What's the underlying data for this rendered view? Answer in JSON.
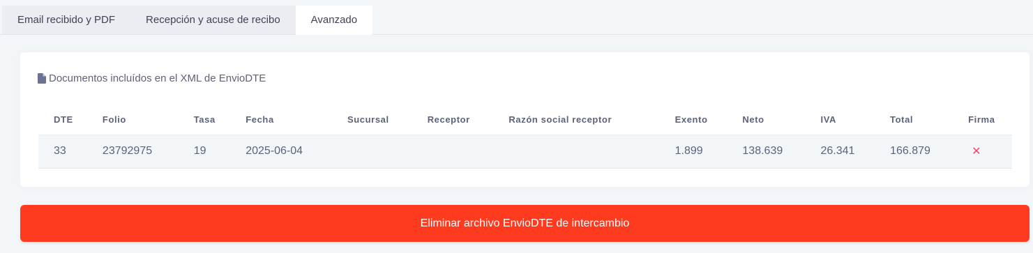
{
  "tabs": [
    {
      "label": "Email recibido y PDF"
    },
    {
      "label": "Recepción y acuse de recibo"
    },
    {
      "label": "Avanzado"
    }
  ],
  "card": {
    "title": "Documentos incluídos en el XML de EnvioDTE",
    "title_icon": "file-icon"
  },
  "table": {
    "columns": [
      "DTE",
      "Folio",
      "Tasa",
      "Fecha",
      "Sucursal",
      "Receptor",
      "Razón social receptor",
      "Exento",
      "Neto",
      "IVA",
      "Total",
      "Firma"
    ],
    "rows": [
      {
        "dte": "33",
        "folio": "23792975",
        "tasa": "19",
        "fecha": "2025-06-04",
        "sucursal": "",
        "receptor": "",
        "razon_social": "",
        "exento": "1.899",
        "neto": "138.639",
        "iva": "26.341",
        "total": "166.879",
        "firma": "✕"
      }
    ]
  },
  "actions": {
    "delete_label": "Eliminar archivo EnvioDTE de intercambio"
  },
  "colors": {
    "danger": "#ff3b1f",
    "firma_invalid": "#f1416c"
  }
}
